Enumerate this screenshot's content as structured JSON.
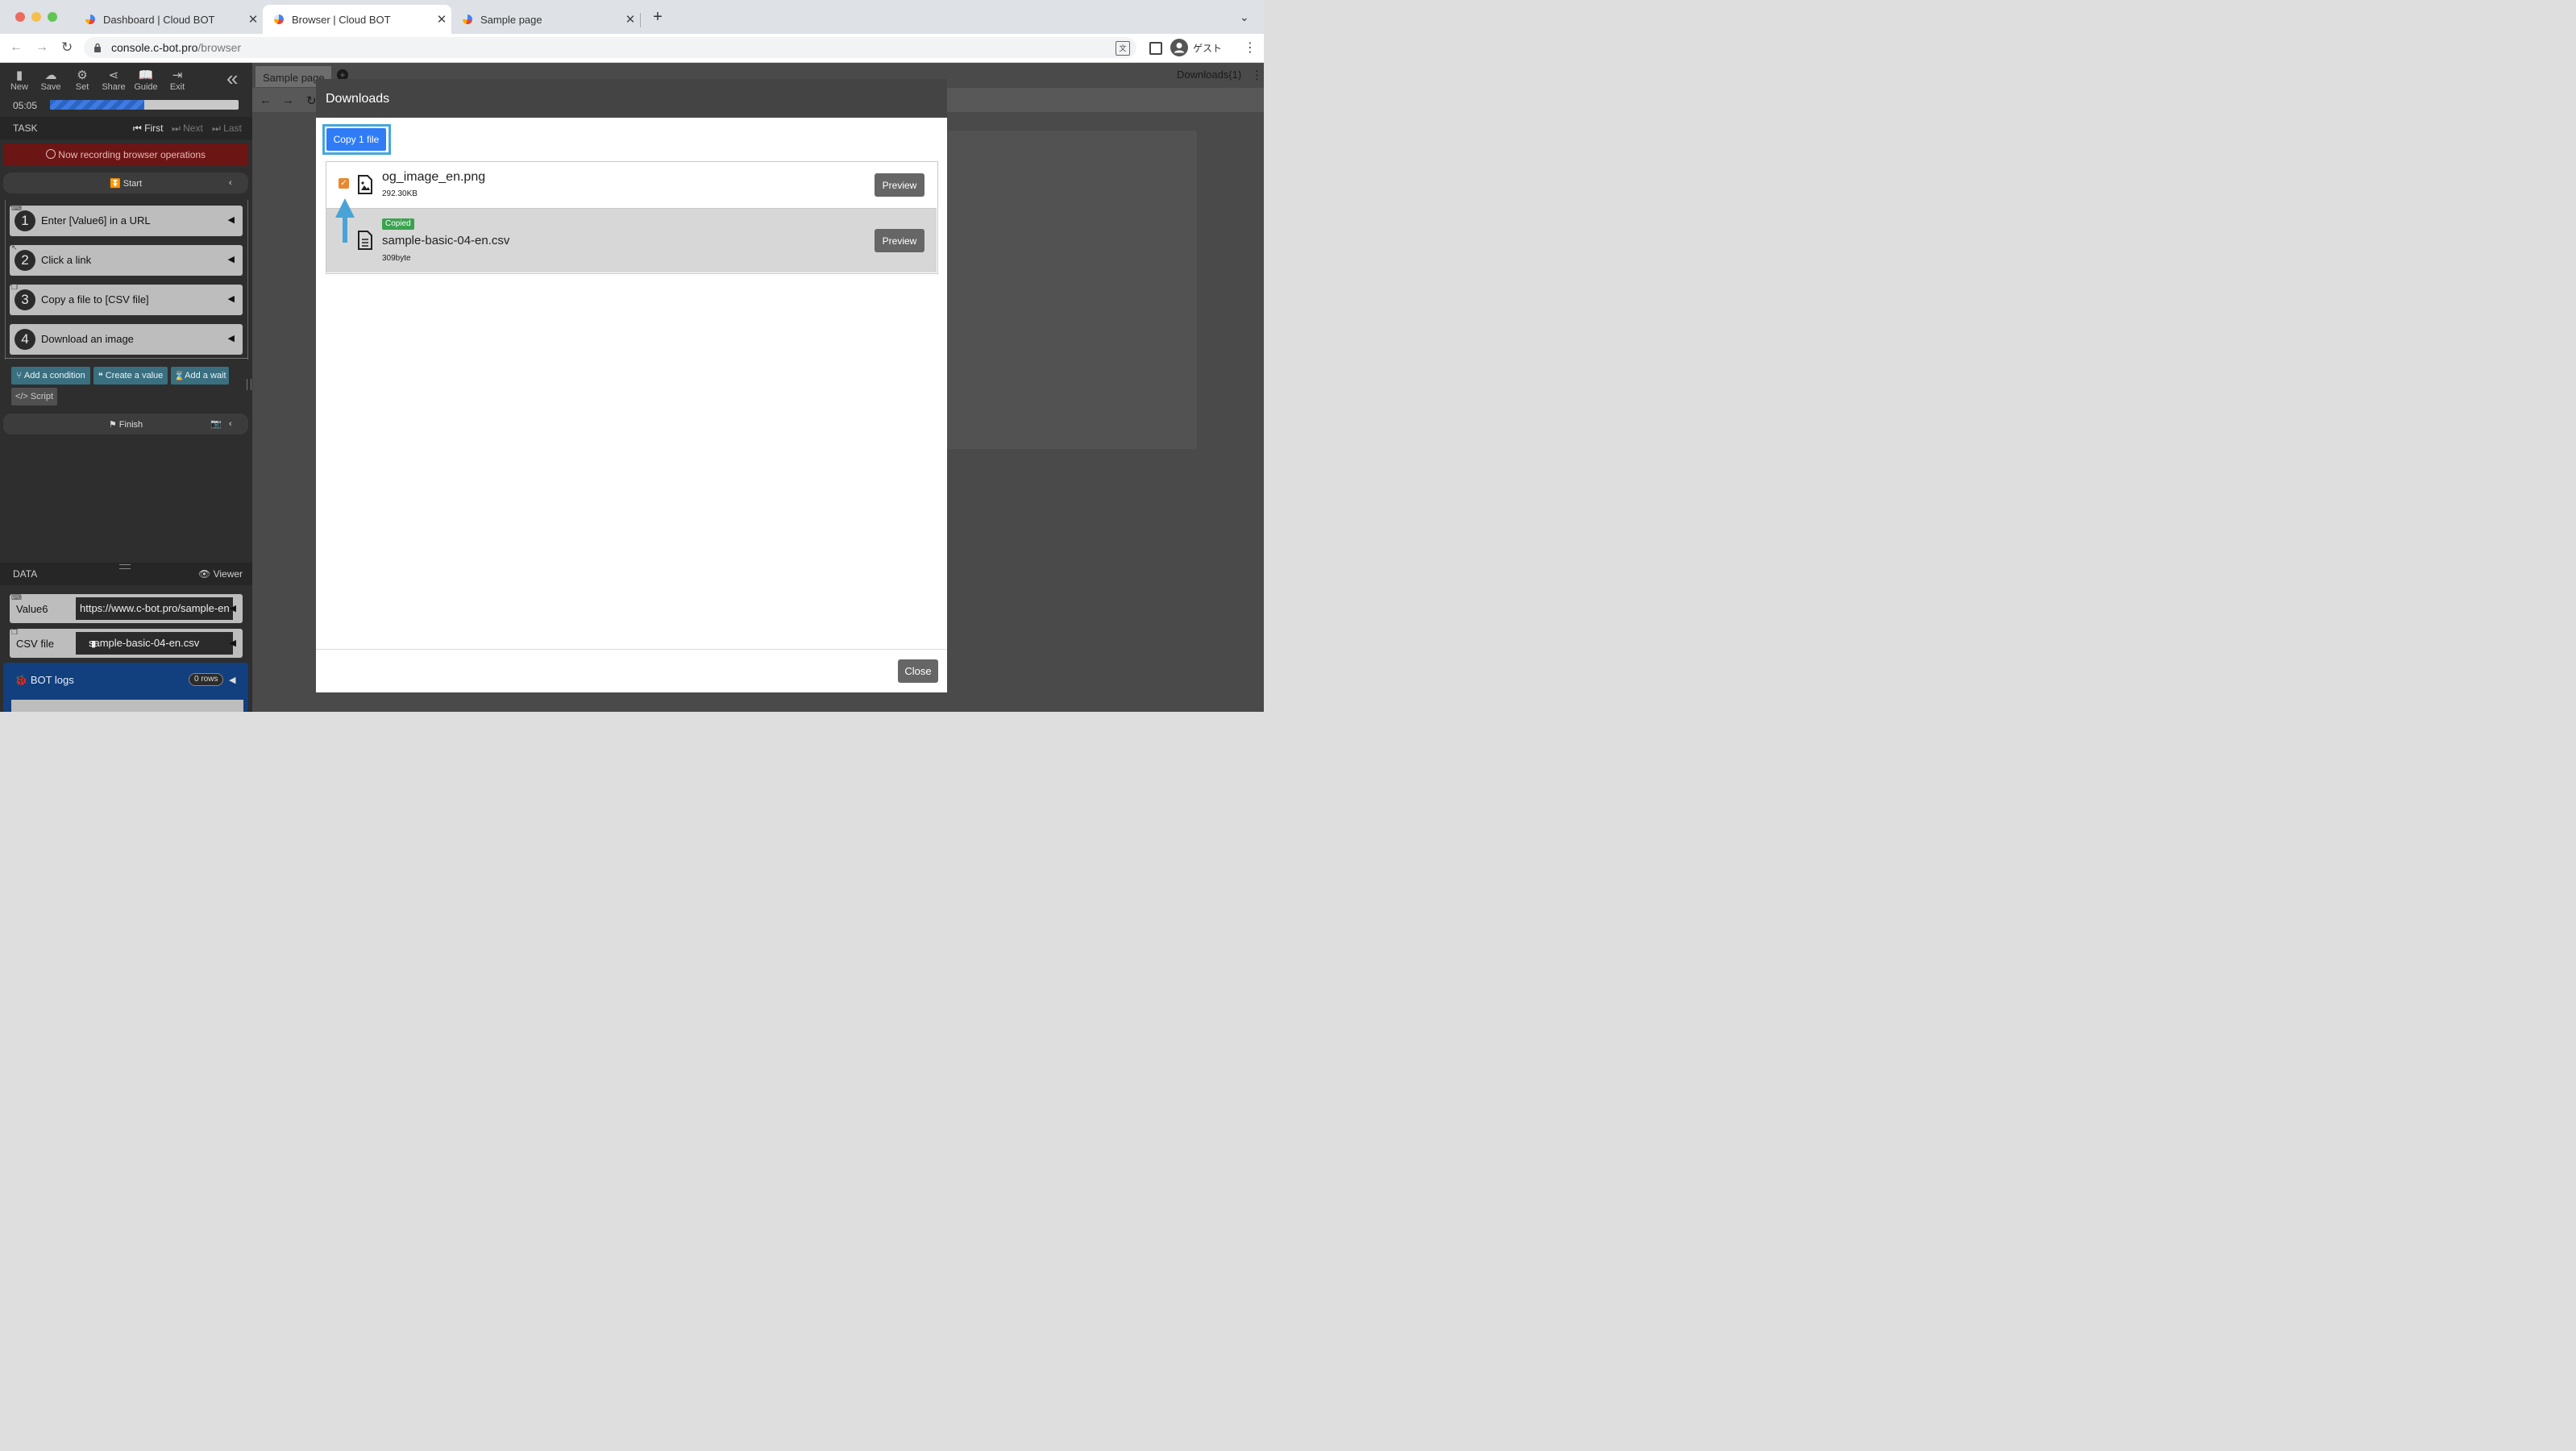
{
  "browser": {
    "tabs": [
      {
        "title": "Dashboard | Cloud BOT"
      },
      {
        "title": "Browser | Cloud BOT"
      },
      {
        "title": "Sample page"
      }
    ],
    "url_host": "console.c-bot.pro",
    "url_path": "/browser",
    "profile_label": "ゲスト"
  },
  "toolbar": {
    "items": [
      {
        "label": "New",
        "icon": "file-icon"
      },
      {
        "label": "Save",
        "icon": "cloud-upload-icon"
      },
      {
        "label": "Set",
        "icon": "gear-icon"
      },
      {
        "label": "Share",
        "icon": "share-icon"
      },
      {
        "label": "Guide",
        "icon": "book-icon"
      },
      {
        "label": "Exit",
        "icon": "exit-icon"
      }
    ],
    "timer": "05:05",
    "progress": 0.5
  },
  "task": {
    "header": "TASK",
    "nav": {
      "first": "First",
      "next": "Next",
      "last": "Last"
    },
    "recording_banner": "Now recording browser operations",
    "start_label": "Start",
    "steps": [
      {
        "num": "1",
        "label": "Enter [Value6] in a URL"
      },
      {
        "num": "2",
        "label": "Click a link"
      },
      {
        "num": "3",
        "label": "Copy a file to [CSV file]"
      },
      {
        "num": "4",
        "label": "Download an image"
      }
    ],
    "actions": {
      "add_condition": "Add a condition",
      "create_value": "Create a value",
      "add_wait": "Add a wait",
      "script": "Script"
    },
    "finish_label": "Finish"
  },
  "data_panel": {
    "header": "DATA",
    "viewer": "Viewer",
    "rows": [
      {
        "key": "Value6",
        "value": "https://www.c-bot.pro/sample-en"
      },
      {
        "key": "CSV file",
        "value": "sample-basic-04-en.csv"
      }
    ],
    "bot_logs": "BOT logs",
    "bot_logs_count": "0 rows"
  },
  "inner_browser": {
    "tab_label": "Sample page",
    "downloads_label": "Downloads(1)"
  },
  "modal": {
    "title": "Downloads",
    "copy_button": "Copy 1 file",
    "files": [
      {
        "name": "og_image_en.png",
        "size": "292.30KB",
        "checked": true,
        "preview": "Preview"
      },
      {
        "name": "sample-basic-04-en.csv",
        "size": "309byte",
        "badge": "Copied",
        "preview": "Preview"
      }
    ],
    "close_button": "Close"
  },
  "colors": {
    "recording_bg": "#6b1515",
    "primary_blue": "#2f7cf6",
    "highlight_border": "#45a7d8",
    "arrow_blue": "#4aa3d6",
    "badge_green": "#3aa34f",
    "checkbox_orange": "#e8892f",
    "logs_bg": "#123f7d"
  }
}
